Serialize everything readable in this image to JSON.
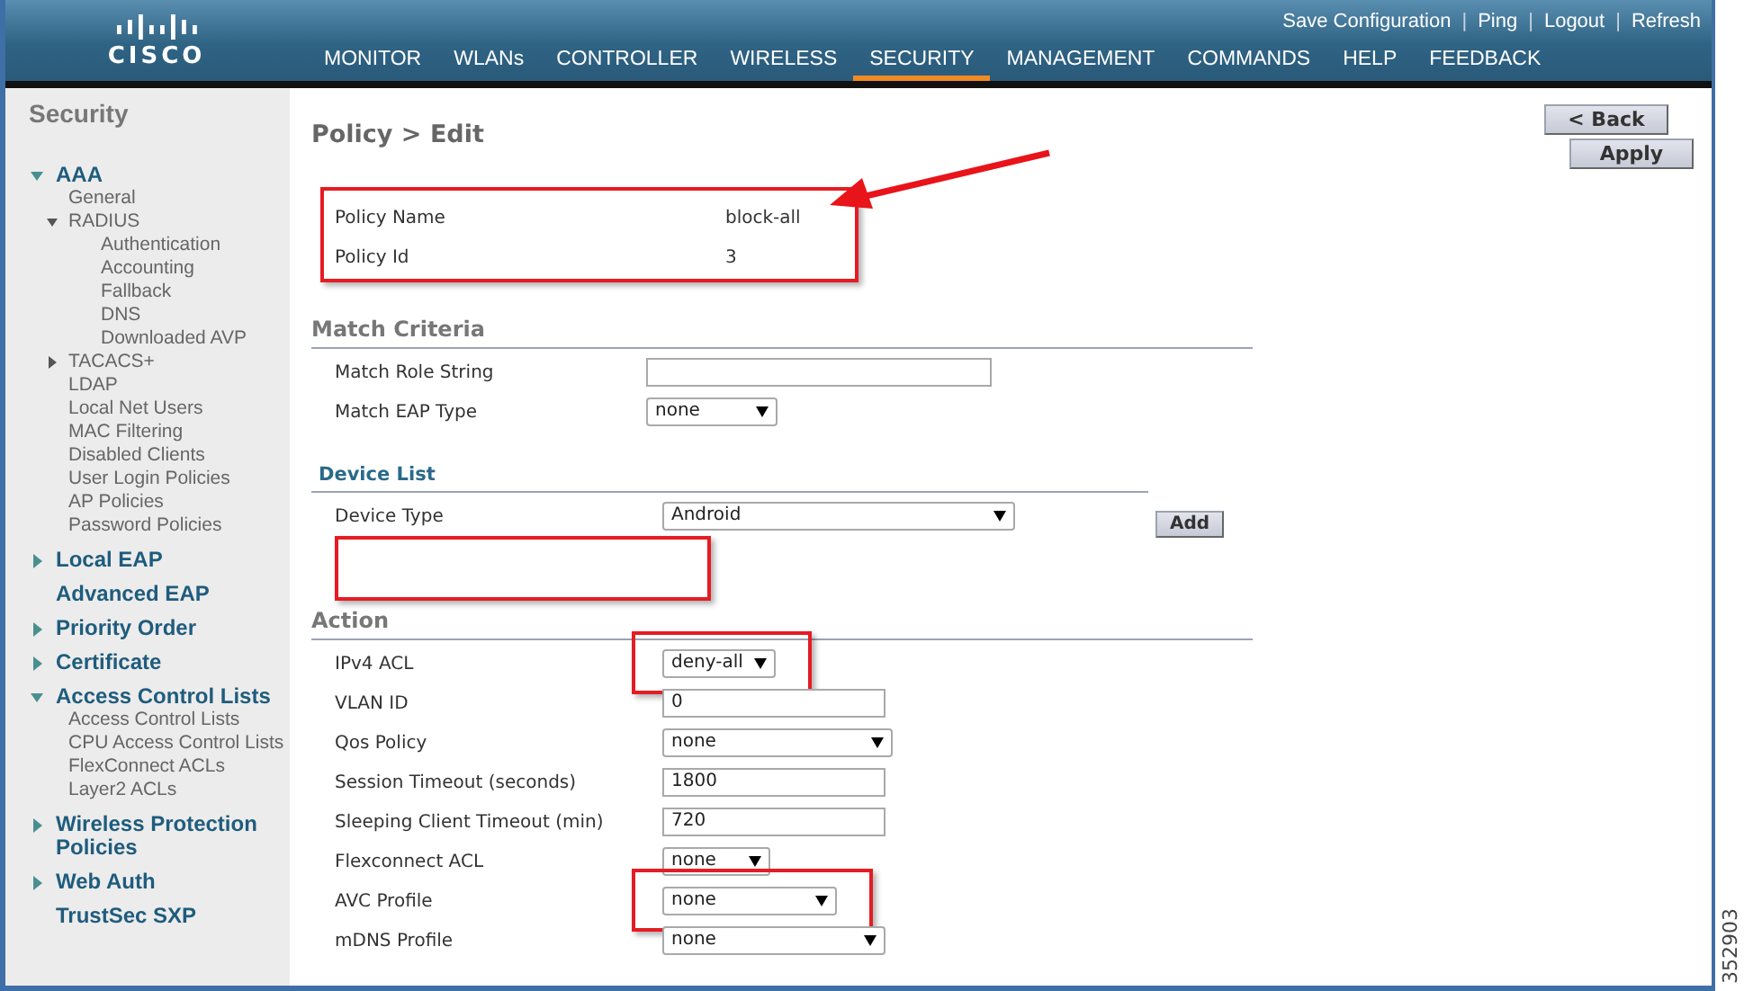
{
  "header": {
    "logo_text": "CISCO",
    "top_links": [
      {
        "label": "Save Configuration"
      },
      {
        "label": "Ping"
      },
      {
        "label": "Logout"
      },
      {
        "label": "Refresh"
      }
    ],
    "top_link_separator": "|",
    "nav": [
      {
        "label": "MONITOR",
        "selected": false
      },
      {
        "label": "WLANs",
        "selected": false
      },
      {
        "label": "CONTROLLER",
        "selected": false
      },
      {
        "label": "WIRELESS",
        "selected": false
      },
      {
        "label": "SECURITY",
        "selected": true
      },
      {
        "label": "MANAGEMENT",
        "selected": false
      },
      {
        "label": "COMMANDS",
        "selected": false
      },
      {
        "label": "HELP",
        "selected": false
      },
      {
        "label": "FEEDBACK",
        "selected": false
      }
    ]
  },
  "sidebar": {
    "title": "Security",
    "items": [
      {
        "label": "AAA",
        "expanded": true,
        "children": [
          {
            "label": "General"
          },
          {
            "label": "RADIUS",
            "expanded": true,
            "children": [
              {
                "label": "Authentication"
              },
              {
                "label": "Accounting"
              },
              {
                "label": "Fallback"
              },
              {
                "label": "DNS"
              },
              {
                "label": "Downloaded AVP"
              }
            ]
          },
          {
            "label": "TACACS+",
            "expanded": false
          },
          {
            "label": "LDAP"
          },
          {
            "label": "Local Net Users"
          },
          {
            "label": "MAC Filtering"
          },
          {
            "label": "Disabled Clients"
          },
          {
            "label": "User Login Policies"
          },
          {
            "label": "AP Policies"
          },
          {
            "label": "Password Policies"
          }
        ]
      },
      {
        "label": "Local EAP",
        "expanded": false
      },
      {
        "label": "Advanced EAP"
      },
      {
        "label": "Priority Order",
        "expanded": false
      },
      {
        "label": "Certificate",
        "expanded": false
      },
      {
        "label": "Access Control Lists",
        "expanded": true,
        "children": [
          {
            "label": "Access Control Lists"
          },
          {
            "label": "CPU Access Control Lists"
          },
          {
            "label": "FlexConnect ACLs"
          },
          {
            "label": "Layer2 ACLs"
          }
        ]
      },
      {
        "label": "Wireless Protection Policies",
        "expanded": false
      },
      {
        "label": "Web Auth",
        "expanded": false
      },
      {
        "label": "TrustSec SXP"
      }
    ]
  },
  "page": {
    "title": "Policy > Edit",
    "buttons": [
      {
        "label": "< Back"
      },
      {
        "label": "Apply"
      }
    ],
    "policy_info": {
      "highlighted": true,
      "callout_arrow": true,
      "rows": [
        {
          "label": "Policy Name",
          "value": "block-all"
        },
        {
          "label": "Policy Id",
          "value": "3"
        }
      ]
    },
    "match_criteria": {
      "heading": "Match Criteria",
      "fields": [
        {
          "label": "Match Role String",
          "kind": "text",
          "highlighted": false
        },
        {
          "label": "Match EAP Type",
          "kind": "select",
          "value": "none",
          "highlighted": false
        }
      ]
    },
    "device_list": {
      "heading": "Device List",
      "field": {
        "label": "Device Type",
        "kind": "select",
        "value": "Android"
      },
      "add_button": "Add",
      "list_highlighted": true
    },
    "action": {
      "heading": "Action",
      "fields": [
        {
          "label": "IPv4 ACL",
          "kind": "select",
          "value": "deny-all",
          "highlighted": true
        },
        {
          "label": "VLAN ID",
          "kind": "text",
          "value": "0",
          "highlighted": false
        },
        {
          "label": "Qos Policy",
          "kind": "select",
          "value": "none",
          "highlighted": false
        },
        {
          "label": "Session Timeout (seconds)",
          "kind": "text",
          "value": "1800",
          "highlighted": false
        },
        {
          "label": "Sleeping Client Timeout (min)",
          "kind": "text",
          "value": "720",
          "highlighted": false
        },
        {
          "label": "Flexconnect ACL",
          "kind": "select",
          "value": "none",
          "highlighted": false
        },
        {
          "label": "AVC Profile",
          "kind": "select",
          "value": "none",
          "highlighted": true
        },
        {
          "label": "mDNS Profile",
          "kind": "select",
          "value": "none",
          "highlighted": false
        }
      ]
    }
  },
  "figure_id": "352903"
}
